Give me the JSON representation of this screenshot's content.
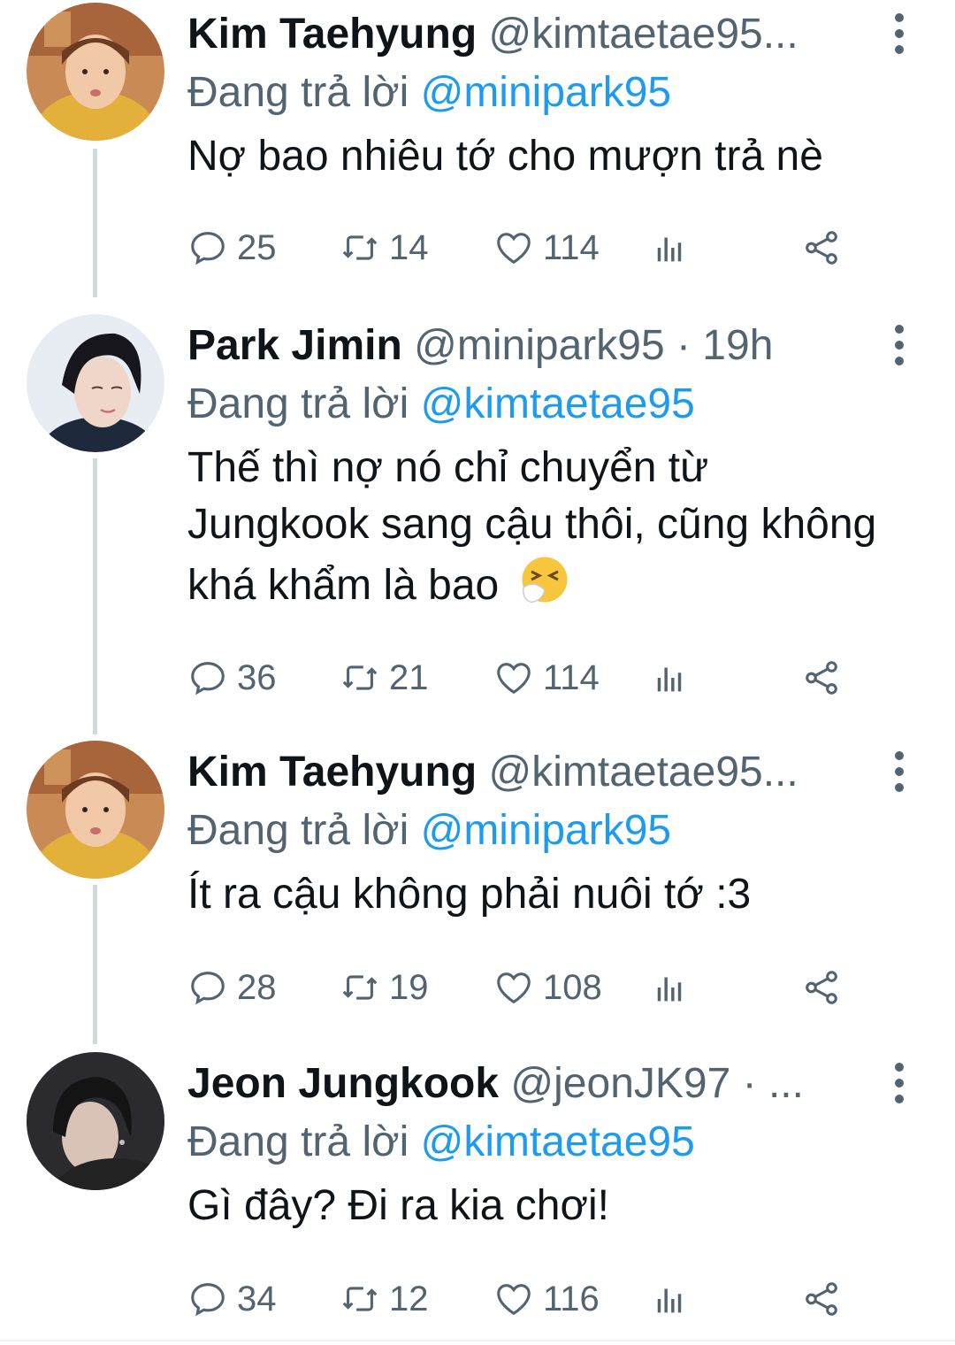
{
  "colors": {
    "accent": "#1d9bf0",
    "secondary_text": "#536471",
    "primary_text": "#0f1419",
    "thread_line": "#cfd9de"
  },
  "tweets": [
    {
      "display_name": "Kim Taehyung",
      "handle": "@kimtaetae95...",
      "reply_prefix": "Đang trả lời",
      "reply_to": "@minipark95",
      "body": "Nợ bao nhiêu tớ cho mượn trả nè",
      "replies": "25",
      "retweets": "14",
      "likes": "114",
      "avatar": "avatar-taehyung"
    },
    {
      "display_name": "Park Jimin",
      "handle": "@minipark95 · 19h",
      "reply_prefix": "Đang trả lời",
      "reply_to": "@kimtaetae95",
      "body": "Thế thì nợ nó chỉ chuyển từ Jungkook sang cậu thôi, cũng không khá khẩm là bao",
      "body_emoji": "sneezing-face-emoji",
      "replies": "36",
      "retweets": "21",
      "likes": "114",
      "avatar": "avatar-jimin"
    },
    {
      "display_name": "Kim Taehyung",
      "handle": "@kimtaetae95...",
      "reply_prefix": "Đang trả lời",
      "reply_to": "@minipark95",
      "body": "Ít ra cậu không phải nuôi tớ :3",
      "replies": "28",
      "retweets": "19",
      "likes": "108",
      "avatar": "avatar-taehyung"
    },
    {
      "display_name": "Jeon Jungkook",
      "handle": "@jeonJK97 · ...",
      "reply_prefix": "Đang trả lời",
      "reply_to": "@kimtaetae95",
      "body": "Gì đây? Đi ra kia chơi!",
      "replies": "34",
      "retweets": "12",
      "likes": "116",
      "avatar": "avatar-jungkook"
    }
  ]
}
